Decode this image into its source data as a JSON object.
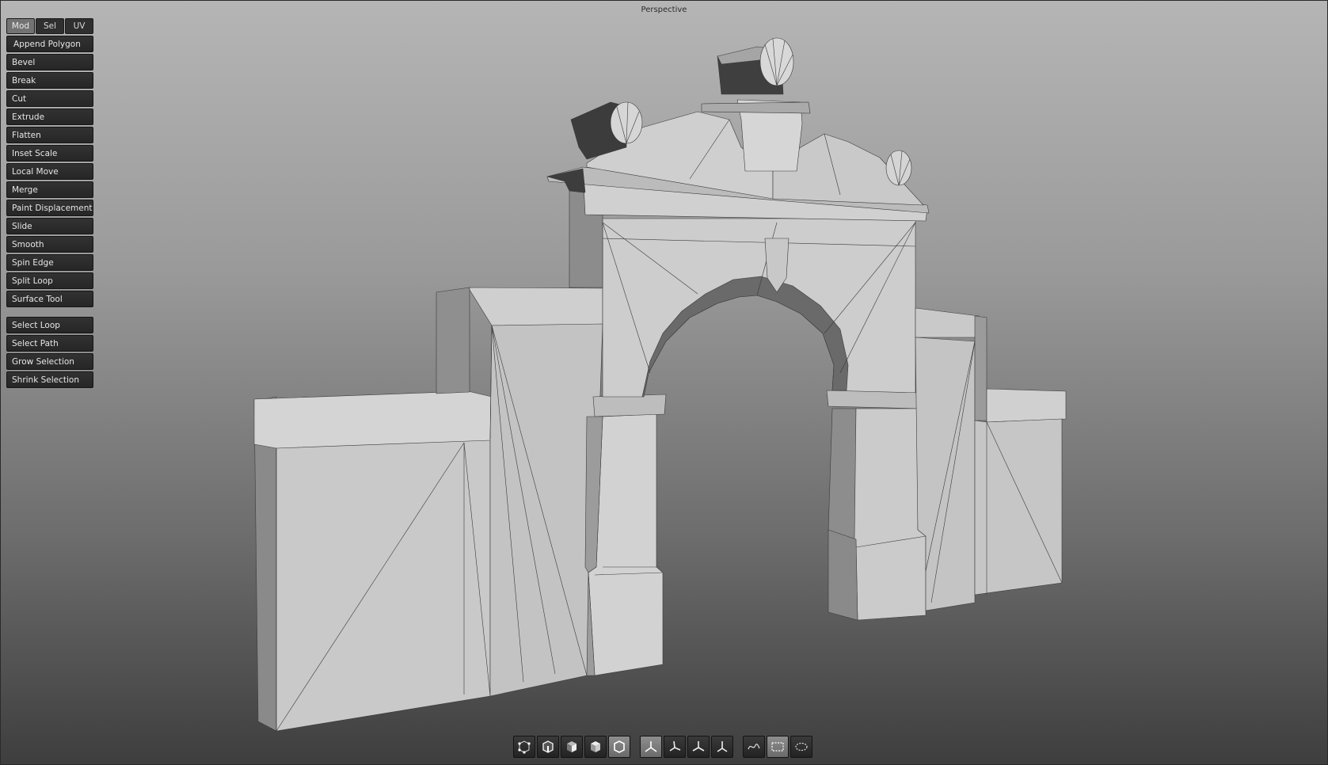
{
  "viewport": {
    "label": "Perspective"
  },
  "tool_panel": {
    "tabs": [
      {
        "label": "Mod",
        "active": true
      },
      {
        "label": "Sel",
        "active": false
      },
      {
        "label": "UV",
        "active": false
      }
    ],
    "modeling_tools": [
      "Append Polygon",
      "Bevel",
      "Break",
      "Cut",
      "Extrude",
      "Flatten",
      "Inset Scale",
      "Local Move",
      "Merge",
      "Paint Displacement",
      "Slide",
      "Smooth",
      "Spin Edge",
      "Split Loop",
      "Surface Tool"
    ],
    "selection_tools": [
      "Select Loop",
      "Select Path",
      "Grow Selection",
      "Shrink Selection"
    ]
  },
  "bottom_toolbar": {
    "component_modes": [
      {
        "icon": "vertex-mode-icon",
        "active": false
      },
      {
        "icon": "edge-mode-icon",
        "active": false
      },
      {
        "icon": "face-mode-icon",
        "active": false
      },
      {
        "icon": "object-mode-icon",
        "active": false
      },
      {
        "icon": "uv-shell-mode-icon",
        "active": true
      }
    ],
    "transform_tools": [
      {
        "icon": "world-axis-icon",
        "active": true
      },
      {
        "icon": "local-axis-icon",
        "active": false
      },
      {
        "icon": "screen-axis-icon",
        "active": false
      },
      {
        "icon": "custom-axis-icon",
        "active": false
      }
    ],
    "selection_shapes": [
      {
        "icon": "freehand-select-icon",
        "active": false
      },
      {
        "icon": "rectangle-select-icon",
        "active": true
      },
      {
        "icon": "lasso-select-icon",
        "active": false
      }
    ]
  }
}
